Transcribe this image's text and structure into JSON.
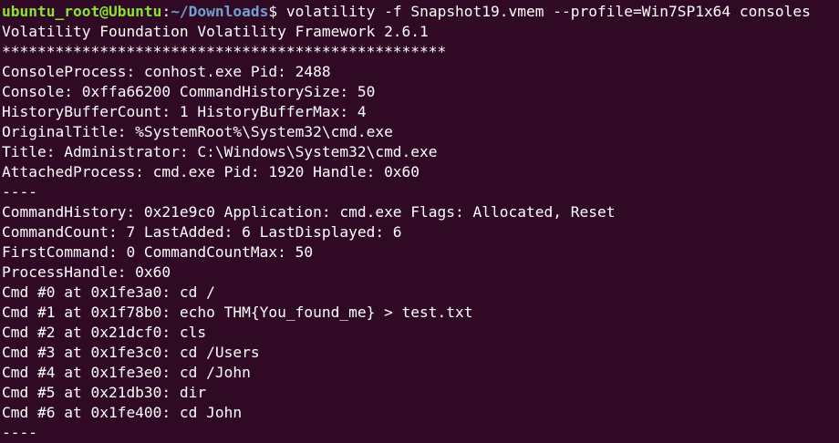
{
  "terminal": {
    "prompt": {
      "user_host": "ubuntu_root@Ubuntu",
      "colon": ":",
      "path": "~/Downloads",
      "symbol": "$ ",
      "command": "volatility -f Snapshot19.vmem --profile=Win7SP1x64 consoles"
    },
    "lines": [
      "Volatility Foundation Volatility Framework 2.6.1",
      "**************************************************",
      "ConsoleProcess: conhost.exe Pid: 2488",
      "Console: 0xffa66200 CommandHistorySize: 50",
      "HistoryBufferCount: 1 HistoryBufferMax: 4",
      "OriginalTitle: %SystemRoot%\\System32\\cmd.exe",
      "Title: Administrator: C:\\Windows\\System32\\cmd.exe",
      "AttachedProcess: cmd.exe Pid: 1920 Handle: 0x60",
      "----",
      "CommandHistory: 0x21e9c0 Application: cmd.exe Flags: Allocated, Reset",
      "CommandCount: 7 LastAdded: 6 LastDisplayed: 6",
      "FirstCommand: 0 CommandCountMax: 50",
      "ProcessHandle: 0x60",
      "Cmd #0 at 0x1fe3a0: cd /",
      "Cmd #1 at 0x1f78b0: echo THM{You_found_me} > test.txt",
      "Cmd #2 at 0x21dcf0: cls",
      "Cmd #3 at 0x1fe3c0: cd /Users",
      "Cmd #4 at 0x1fe3e0: cd /John",
      "Cmd #5 at 0x21db30: dir",
      "Cmd #6 at 0x1fe400: cd John",
      "----"
    ]
  },
  "colors": {
    "background": "#300a24",
    "text": "#ffffff",
    "prompt_user": "#8ae234",
    "prompt_path": "#729fcf"
  }
}
